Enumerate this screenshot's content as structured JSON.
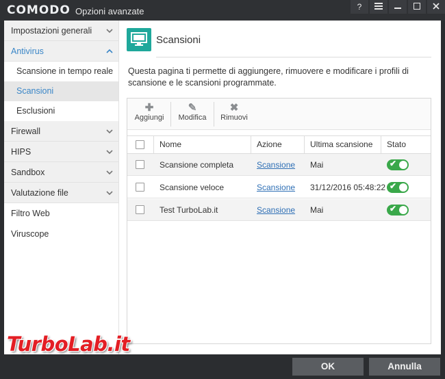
{
  "titlebar": {
    "brand": "COMODO",
    "subtitle": "Opzioni avanzate",
    "help_label": "?",
    "menu_icon": "menu-icon",
    "minimize_icon": "minimize-icon",
    "maximize_icon": "maximize-icon",
    "close_icon": "close-icon"
  },
  "sidebar": {
    "items": [
      {
        "label": "Impostazioni generali",
        "icon": "chevron-down-icon"
      },
      {
        "label": "Antivirus",
        "icon": "chevron-up-icon"
      },
      {
        "label": "Scansione in tempo reale"
      },
      {
        "label": "Scansioni"
      },
      {
        "label": "Esclusioni"
      },
      {
        "label": "Firewall",
        "icon": "chevron-down-icon"
      },
      {
        "label": "HIPS",
        "icon": "chevron-down-icon"
      },
      {
        "label": "Sandbox",
        "icon": "chevron-down-icon"
      },
      {
        "label": "Valutazione file",
        "icon": "chevron-down-icon"
      },
      {
        "label": "Filtro Web"
      },
      {
        "label": "Viruscope"
      }
    ]
  },
  "main": {
    "page_icon": "monitor-icon",
    "title": "Scansioni",
    "description": "Questa pagina ti permette di aggiungere, rimuovere e modificare i profili di scansione e le scansioni programmate."
  },
  "toolbar": {
    "add_label": "Aggiungi",
    "edit_label": "Modifica",
    "remove_label": "Rimuovi",
    "add_icon": "plus-icon",
    "edit_icon": "pencil-icon",
    "remove_icon": "x-icon"
  },
  "table": {
    "columns": [
      "Nome",
      "Azione",
      "Ultima scansione",
      "Stato"
    ],
    "rows": [
      {
        "name": "Scansione completa",
        "action": "Scansione",
        "last_scan": "Mai",
        "enabled": true
      },
      {
        "name": "Scansione veloce",
        "action": "Scansione",
        "last_scan": "31/12/2016 05:48:22",
        "enabled": true
      },
      {
        "name": "Test TurboLab.it",
        "action": "Scansione",
        "last_scan": "Mai",
        "enabled": true
      }
    ]
  },
  "footer": {
    "ok_label": "OK",
    "cancel_label": "Annulla"
  },
  "watermark": {
    "text": "TurboLab.it"
  },
  "colors": {
    "accent": "#1fa89b",
    "link": "#2e6fb5",
    "selection_text": "#3a86c7",
    "toggle_on": "#3aa84a",
    "titlebar_bg": "#2f3134"
  }
}
